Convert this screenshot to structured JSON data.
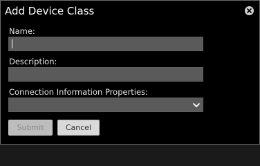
{
  "dialog": {
    "title": "Add Device Class",
    "close_icon": "close-circle-icon"
  },
  "form": {
    "name_label": "Name:",
    "name_value": "",
    "description_label": "Description:",
    "description_value": "",
    "connection_label": "Connection Information Properties:",
    "connection_selected": "",
    "connection_icon": "chevron-down-icon"
  },
  "buttons": {
    "submit_label": "Submit",
    "cancel_label": "Cancel"
  },
  "colors": {
    "dialog_bg": "#000000",
    "field_bg": "#5a5a5a",
    "label_text": "#e6e6e6"
  }
}
